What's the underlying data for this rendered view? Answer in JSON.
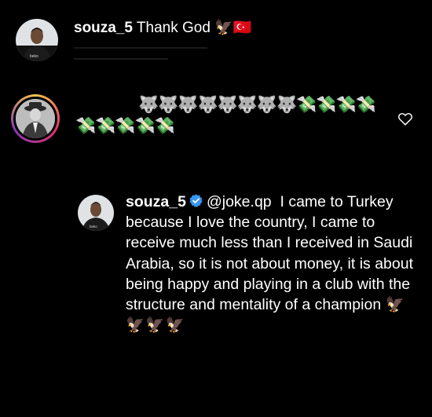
{
  "caption": {
    "username": "souza_5",
    "text": "Thank God",
    "emoji": "🦅🇹🇷"
  },
  "comment": {
    "emoji_line_1": "🐺🐺🐺🐺🐺🐺🐺🐺💸💸💸💸",
    "emoji_line_2": "💸💸💸💸💸",
    "like_icon": "heart-outline-icon"
  },
  "reply": {
    "username": "souza_5",
    "verified_icon": "verified-badge-icon",
    "mention": "@joke.qp",
    "text": "I came to Turkey because I love the country, I came to receive much less than I received in Saudi Arabia, so it is not about money, it is about being happy and playing in a club with the structure and mentality of a champion",
    "emoji": "🦅🦅🦅🦅"
  },
  "colors": {
    "background": "#000000",
    "text": "#ffffff",
    "verified": "#3897f0"
  }
}
